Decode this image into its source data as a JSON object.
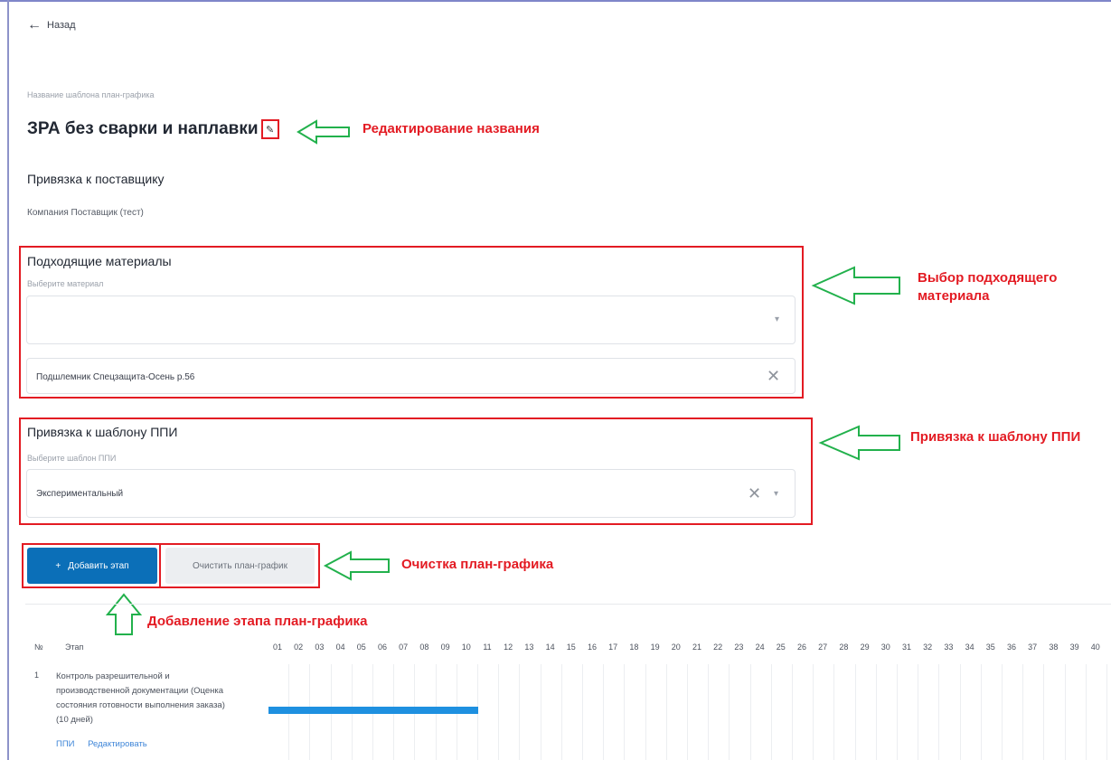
{
  "nav": {
    "back_label": "Назад"
  },
  "template": {
    "name_label": "Название шаблона план-графика",
    "name": "ЗРА без сварки и наплавки"
  },
  "supplier": {
    "title": "Привязка к поставщику",
    "company": "Компания Поставщик (тест)"
  },
  "materials": {
    "title": "Подходящие материалы",
    "hint": "Выберите материал",
    "select_value": "",
    "selected_item": "Подшлемник Спецзащита-Осень р.56"
  },
  "ppi": {
    "title": "Привязка к шаблону ППИ",
    "hint": "Выберите шаблон ППИ",
    "value": "Экспериментальный"
  },
  "buttons": {
    "add_stage": "Добавить этап",
    "clear": "Очистить план-график"
  },
  "annotations": {
    "edit_name": "Редактирование названия",
    "material": "Выбор подходящего материала",
    "ppi": "Привязка к шаблону ППИ",
    "clear": "Очистка план-графика",
    "add": "Добавление этапа план-графика"
  },
  "table": {
    "col_num": "№",
    "col_stage": "Этап",
    "days": [
      "01",
      "02",
      "03",
      "04",
      "05",
      "06",
      "07",
      "08",
      "09",
      "10",
      "11",
      "12",
      "13",
      "14",
      "15",
      "16",
      "17",
      "18",
      "19",
      "20",
      "21",
      "22",
      "23",
      "24",
      "25",
      "26",
      "27",
      "28",
      "29",
      "30",
      "31",
      "32",
      "33",
      "34",
      "35",
      "36",
      "37",
      "38",
      "39",
      "40"
    ],
    "rows": [
      {
        "num": "1",
        "text": "Контроль разрешительной и производственной документации (Оценка состояния готовности выполнения заказа) (10 дней)",
        "link_ppi": "ППИ",
        "link_edit": "Редактировать",
        "start_day": 1,
        "duration_days": 10
      }
    ]
  },
  "colors": {
    "accent": "#0b6fb8",
    "annotation": "#e31b23",
    "arrow": "#22b14c",
    "bar": "#1e90e0"
  }
}
